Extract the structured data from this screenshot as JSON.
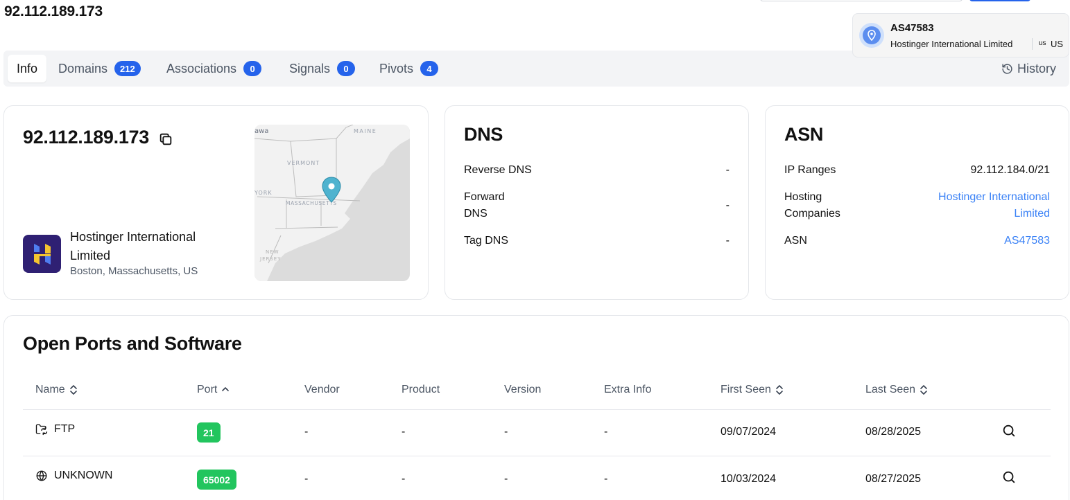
{
  "page": {
    "title": "92.112.189.173"
  },
  "asn_popover": {
    "asn": "AS47583",
    "company": "Hostinger International Limited",
    "flag": "us",
    "country": "US"
  },
  "tabs": [
    {
      "label": "Info",
      "active": true
    },
    {
      "label": "Domains",
      "count": "212"
    },
    {
      "label": "Associations",
      "count": "0"
    },
    {
      "label": "Signals",
      "count": "0"
    },
    {
      "label": "Pivots",
      "count": "4"
    }
  ],
  "history_label": "History",
  "ip_card": {
    "ip": "92.112.189.173",
    "host_name": "Hostinger International Limited",
    "host_location": "Boston, Massachusetts, US",
    "map_labels": [
      "awa",
      "MAINE",
      "VERMONT",
      "YORK",
      "MASSACHUSETTS",
      "NEW",
      "JERSEY"
    ]
  },
  "dns_card": {
    "heading": "DNS",
    "rows": [
      {
        "label": "Reverse DNS",
        "value": "-"
      },
      {
        "label": "Forward DNS",
        "value": "-"
      },
      {
        "label": "Tag DNS",
        "value": "-"
      }
    ]
  },
  "asn_card": {
    "heading": "ASN",
    "rows": [
      {
        "label": "IP Ranges",
        "value": "92.112.184.0/21"
      },
      {
        "label": "Hosting Companies",
        "value": "Hostinger International Limited"
      },
      {
        "label": "ASN",
        "value": "AS47583"
      }
    ]
  },
  "ports": {
    "title": "Open Ports and Software",
    "columns": [
      "Name",
      "Port",
      "Vendor",
      "Product",
      "Version",
      "Extra Info",
      "First Seen",
      "Last Seen"
    ],
    "rows": [
      {
        "icon": "folder-sync-icon",
        "name": "FTP",
        "port": "21",
        "vendor": "-",
        "product": "-",
        "version": "-",
        "extra": "-",
        "first_seen": "09/07/2024",
        "last_seen": "08/28/2025"
      },
      {
        "icon": "globe-icon",
        "name": "UNKNOWN",
        "port": "65002",
        "vendor": "-",
        "product": "-",
        "version": "-",
        "extra": "-",
        "first_seen": "10/03/2024",
        "last_seen": "08/27/2025"
      }
    ]
  },
  "colors": {
    "accent": "#2563eb",
    "link": "#3b82f6",
    "port_badge": "#22c55e",
    "tab_bar": "#f3f4f6",
    "host_logo_bg": "#2f2073"
  }
}
